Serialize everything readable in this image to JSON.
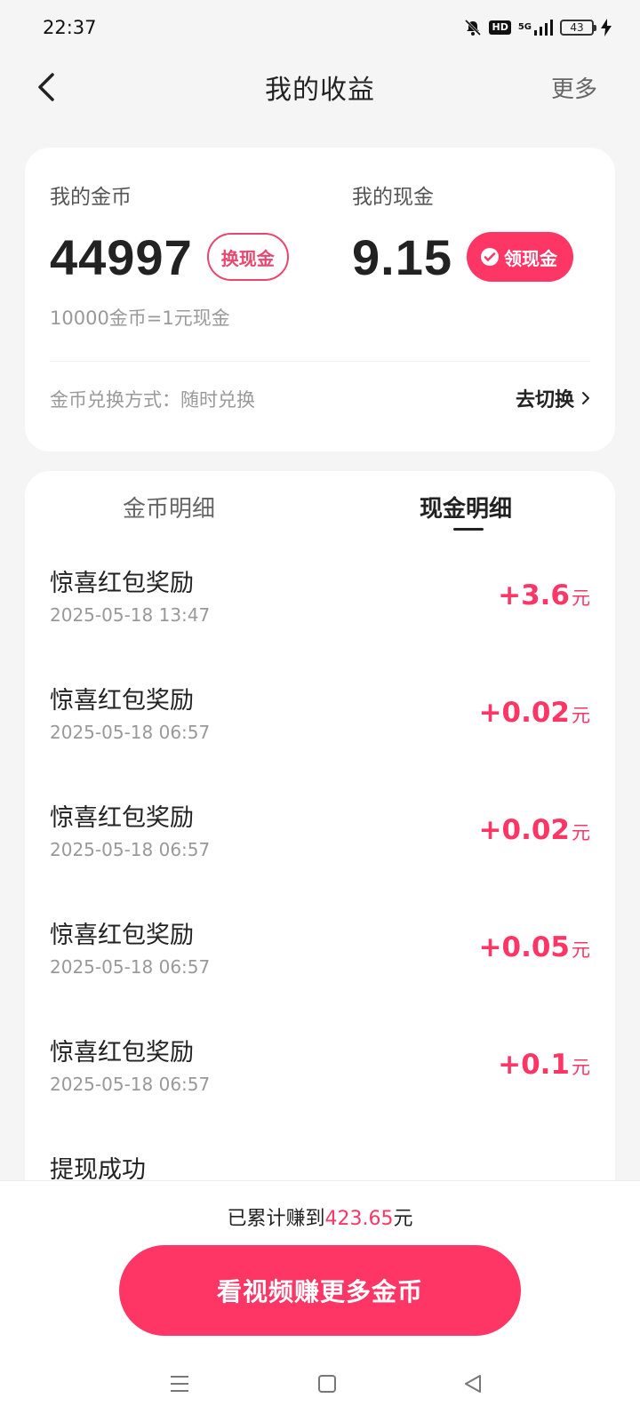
{
  "status_bar": {
    "time": "22:37",
    "network": "5G",
    "hd": "HD",
    "battery": "43",
    "icons": [
      "mute-icon",
      "hd-icon",
      "signal-icon",
      "battery-icon",
      "charging-icon"
    ]
  },
  "header": {
    "title": "我的收益",
    "more": "更多"
  },
  "balance": {
    "coins_label": "我的金币",
    "coins_value": "44997",
    "exchange_button": "换现金",
    "cash_label": "我的现金",
    "cash_value": "9.15",
    "withdraw_button": "领现金",
    "rate": "10000金币=1元现金",
    "exchange_mode": "金币兑换方式：随时兑换",
    "switch_link": "去切换"
  },
  "tabs": [
    {
      "label": "金币明细",
      "active": false
    },
    {
      "label": "现金明细",
      "active": true
    }
  ],
  "transactions": [
    {
      "title": "惊喜红包奖励",
      "time": "2025-05-18 13:47",
      "amount": "+3.6",
      "unit": "元"
    },
    {
      "title": "惊喜红包奖励",
      "time": "2025-05-18 06:57",
      "amount": "+0.02",
      "unit": "元"
    },
    {
      "title": "惊喜红包奖励",
      "time": "2025-05-18 06:57",
      "amount": "+0.02",
      "unit": "元"
    },
    {
      "title": "惊喜红包奖励",
      "time": "2025-05-18 06:57",
      "amount": "+0.05",
      "unit": "元"
    },
    {
      "title": "惊喜红包奖励",
      "time": "2025-05-18 06:57",
      "amount": "+0.1",
      "unit": "元"
    },
    {
      "title": "提现成功",
      "time": "",
      "amount": "",
      "unit": ""
    }
  ],
  "footer": {
    "total_prefix": "已累计赚到",
    "total_amount": "423.65",
    "total_suffix": "元",
    "cta": "看视频赚更多金币"
  },
  "colors": {
    "accent": "#fe3666",
    "accent_outline": "#e8476f",
    "background": "#f5f5f5"
  }
}
